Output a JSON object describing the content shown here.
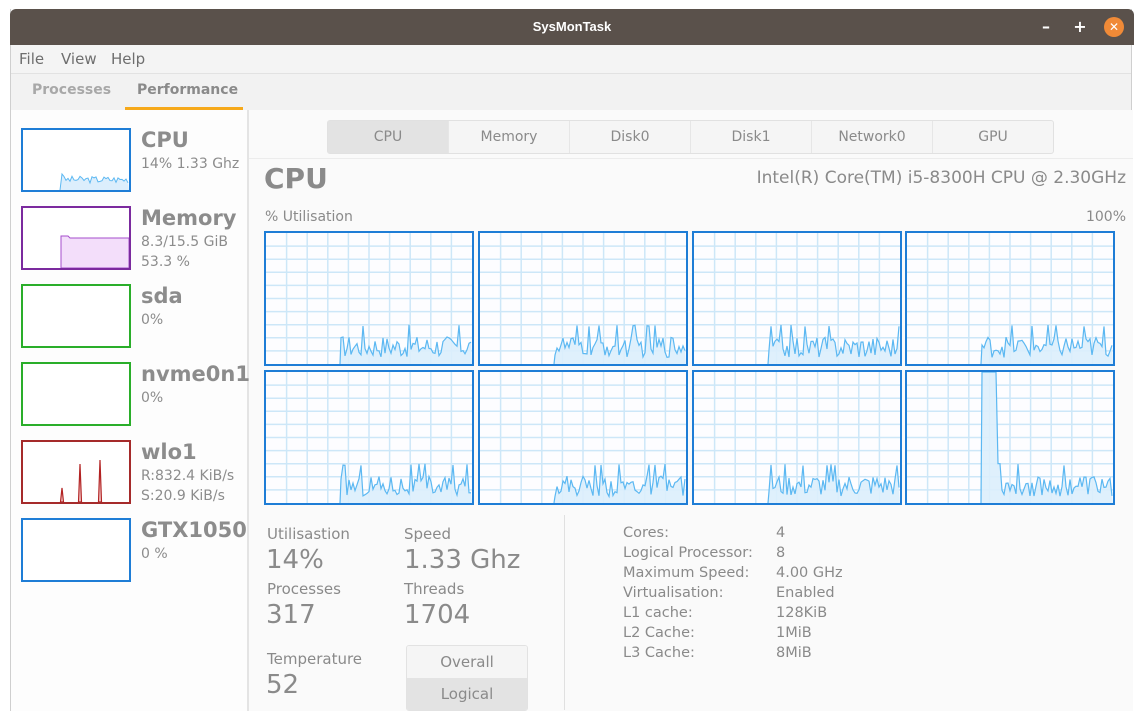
{
  "window": {
    "title": "SysMonTask",
    "controls": {
      "minimize": "–",
      "maximize": "+",
      "close": "✕"
    }
  },
  "menu": [
    "File",
    "View",
    "Help"
  ],
  "main_tabs": [
    {
      "label": "Processes",
      "active": false
    },
    {
      "label": "Performance",
      "active": true
    }
  ],
  "sidebar": {
    "items": [
      {
        "name": "CPU",
        "lines": [
          "14% 1.33 Ghz"
        ],
        "color": "#1e7dd6",
        "fill": "#dceefc",
        "line": "#5cb8f2",
        "kind": "cpu"
      },
      {
        "name": "Memory",
        "lines": [
          "8.3/15.5 GiB",
          "53.3 %"
        ],
        "color": "#7b2a9e",
        "fill": "#f3defa",
        "line": "#a64dcc",
        "kind": "memory"
      },
      {
        "name": "sda",
        "lines": [
          "0%"
        ],
        "color": "#2aae2a",
        "fill": "#e0f5e0",
        "line": "#2aae2a",
        "kind": "empty"
      },
      {
        "name": "nvme0n1",
        "lines": [
          "0%"
        ],
        "color": "#2aae2a",
        "fill": "#e0f5e0",
        "line": "#2aae2a",
        "kind": "empty"
      },
      {
        "name": "wlo1",
        "lines": [
          "R:832.4 KiB/s",
          "S:20.9 KiB/s"
        ],
        "color": "#a52a2a",
        "fill": "#f5d0d0",
        "line": "#b22222",
        "kind": "net"
      },
      {
        "name": "GTX1050",
        "lines": [
          "0 %"
        ],
        "color": "#1e7dd6",
        "fill": "#dceefc",
        "line": "#5cb8f2",
        "kind": "empty"
      }
    ]
  },
  "perf_tabs": [
    {
      "label": "CPU",
      "active": true
    },
    {
      "label": "Memory",
      "active": false
    },
    {
      "label": "Disk0",
      "active": false
    },
    {
      "label": "Disk1",
      "active": false
    },
    {
      "label": "Network0",
      "active": false
    },
    {
      "label": "GPU",
      "active": false
    }
  ],
  "cpu_panel": {
    "title": "CPU",
    "model": "Intel(R) Core(TM) i5-8300H CPU @ 2.30GHz",
    "y_label": "% Utilisation",
    "y_max_label": "100%",
    "graph_colors": {
      "border": "#1e7dd6",
      "grid": "#cde7f8",
      "line": "#5cb8f2",
      "fill": "#dceefc"
    },
    "logical_cores": 8
  },
  "stats": {
    "utilisation": {
      "label": "Utilisastion",
      "value": "14%"
    },
    "speed": {
      "label": "Speed",
      "value": "1.33 Ghz"
    },
    "processes": {
      "label": "Processes",
      "value": "317"
    },
    "threads": {
      "label": "Threads",
      "value": "1704"
    },
    "temperature": {
      "label": "Temperature",
      "value": "52"
    }
  },
  "view_toggle": [
    {
      "label": "Overall",
      "active": false
    },
    {
      "label": "Logical",
      "active": true
    }
  ],
  "cpu_info": [
    {
      "label": "Cores:",
      "value": "4"
    },
    {
      "label": "Logical Processor:",
      "value": "8"
    },
    {
      "label": "Maximum Speed:",
      "value": "4.00 GHz"
    },
    {
      "label": "Virtualisation:",
      "value": "Enabled"
    },
    {
      "label": "L1 cache:",
      "value": "128KiB"
    },
    {
      "label": "L2 Cache:",
      "value": "1MiB"
    },
    {
      "label": "L3 Cache:",
      "value": "8MiB"
    }
  ]
}
